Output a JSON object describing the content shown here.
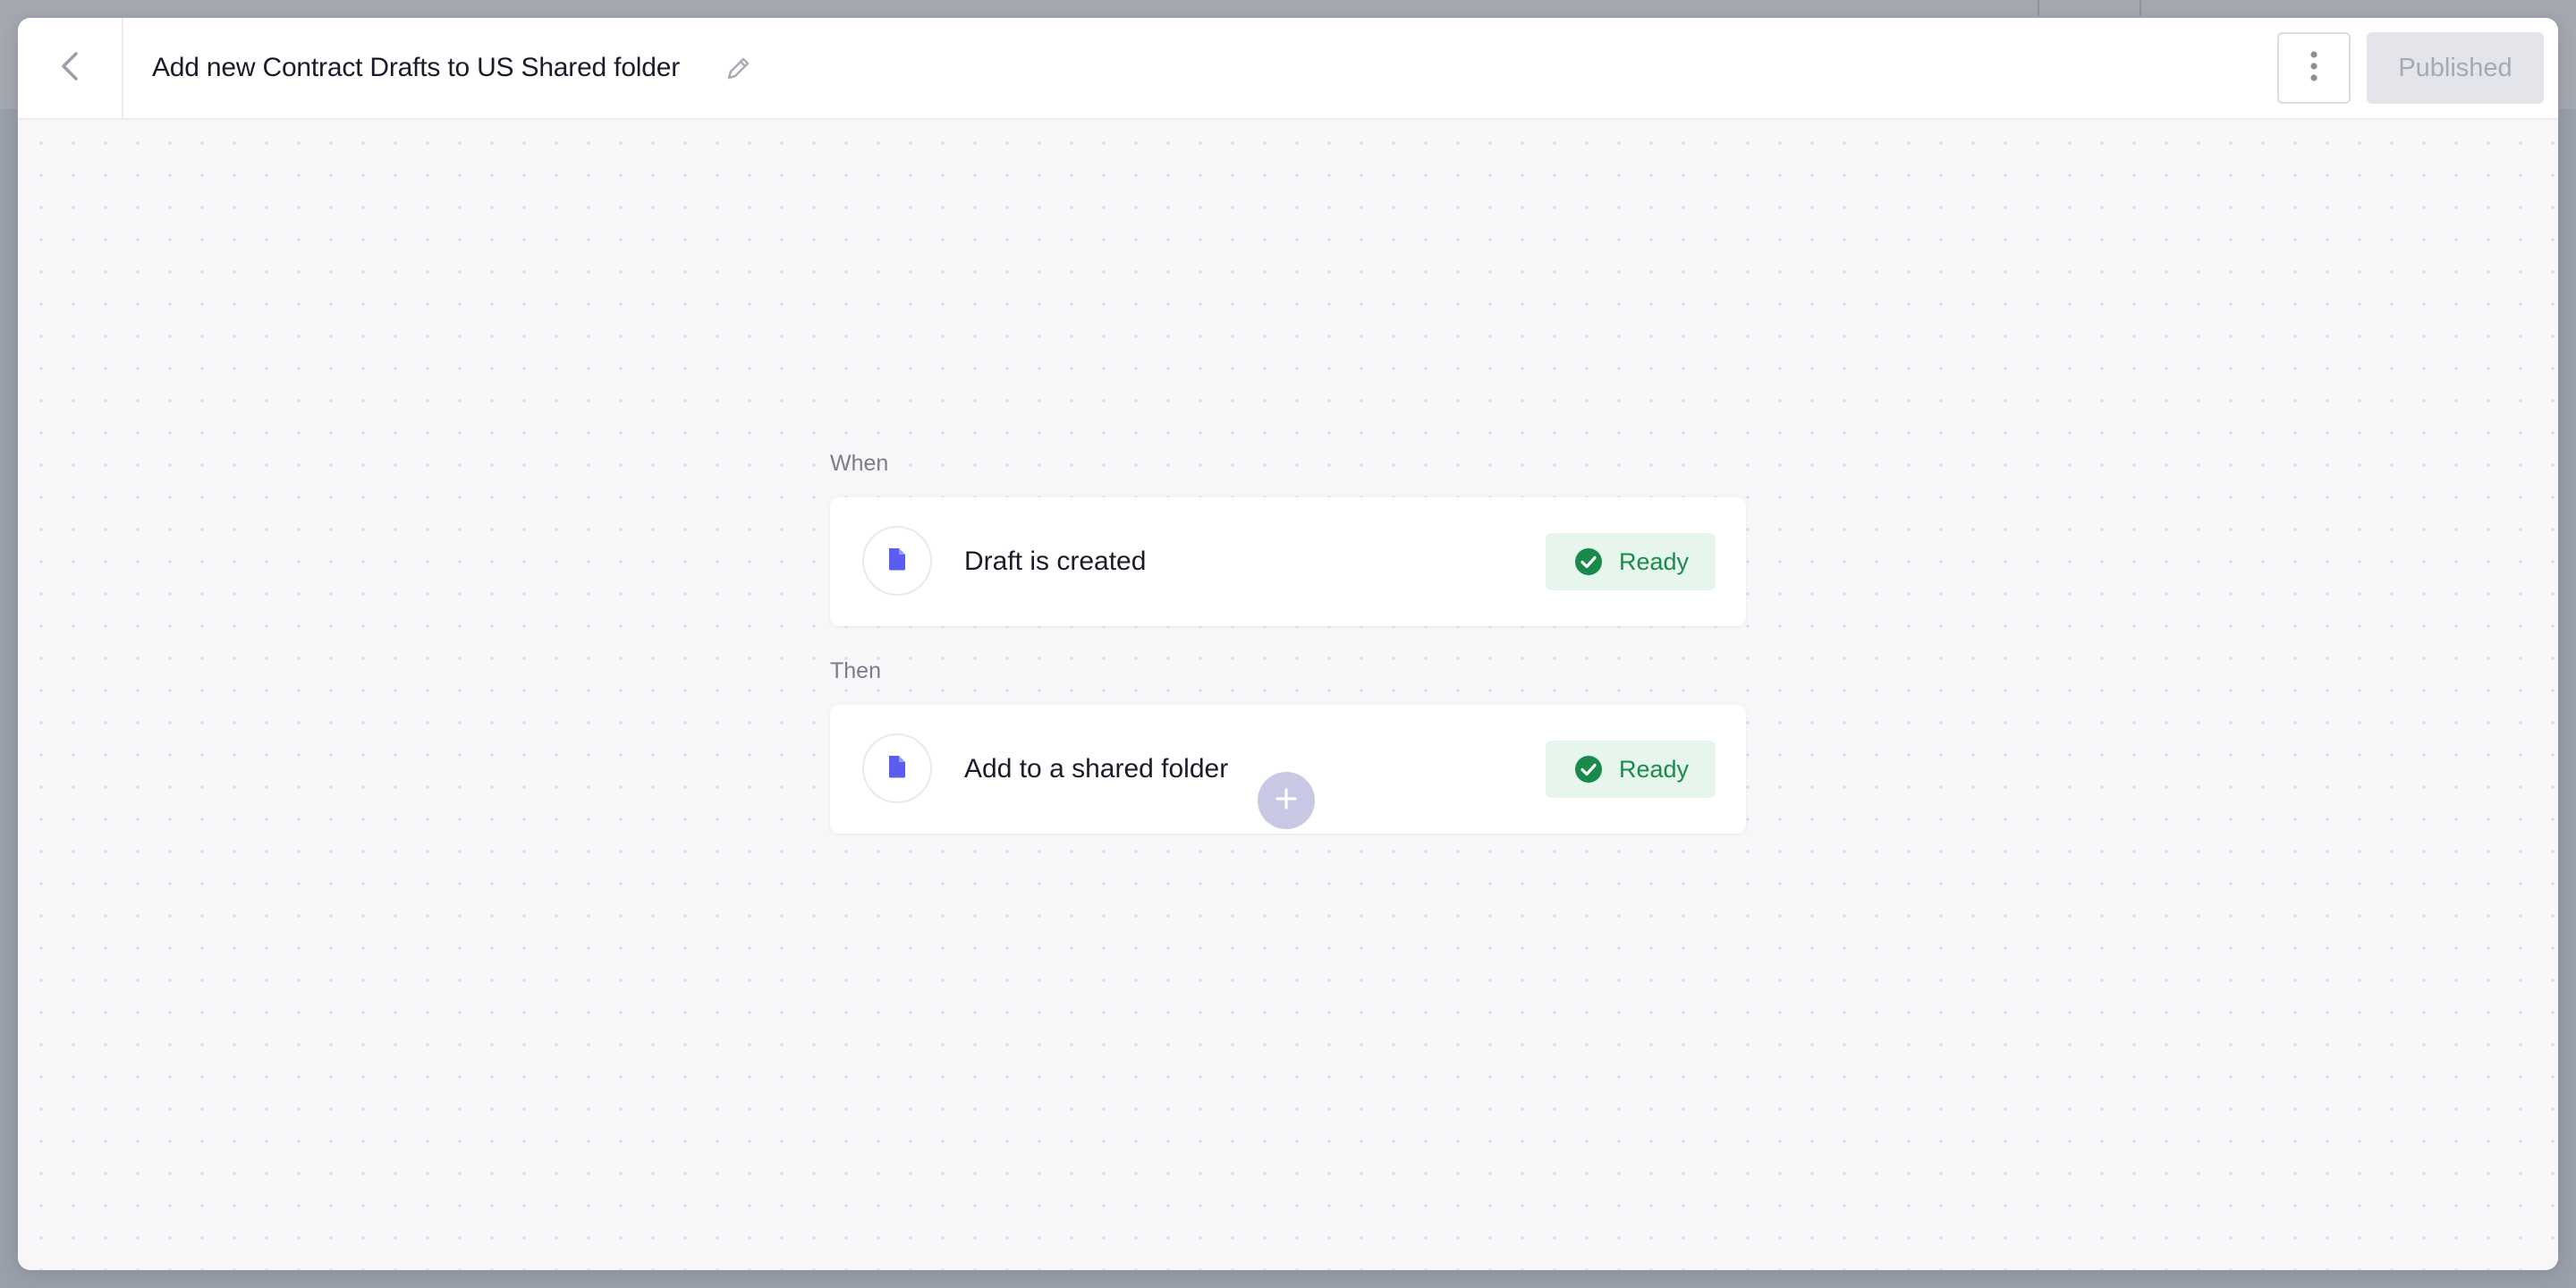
{
  "header": {
    "title": "Add new Contract Drafts to US Shared folder",
    "back_icon": "chevron-left-icon",
    "edit_icon": "pencil-icon",
    "more_icon": "vertical-dots-icon",
    "publish_label": "Published"
  },
  "workflow": {
    "trigger": {
      "section_label": "When",
      "label": "Draft is created",
      "icon": "document-icon",
      "status": "Ready"
    },
    "action": {
      "section_label": "Then",
      "label": "Add to a shared folder",
      "icon": "document-icon",
      "status": "Ready"
    },
    "add_step_icon": "plus-icon"
  },
  "colors": {
    "doc_icon": "#5b5cf0",
    "status_green": "#1a8a4a",
    "status_bg": "#e7f6ec",
    "add_button": "#c7c8e4"
  }
}
